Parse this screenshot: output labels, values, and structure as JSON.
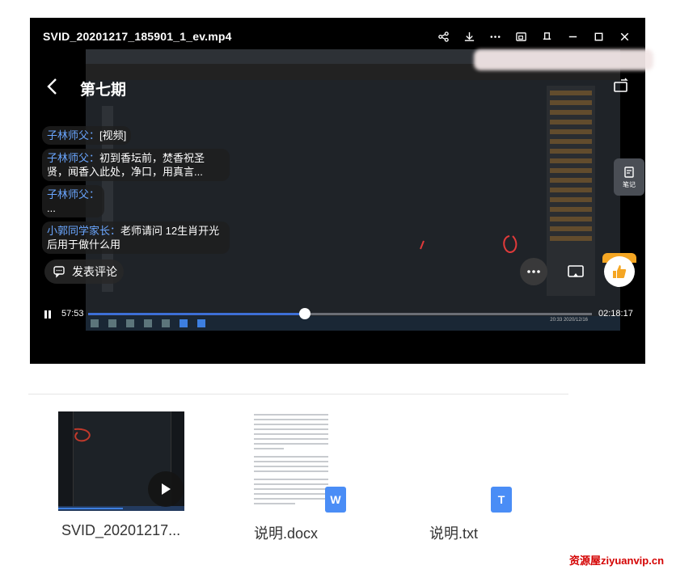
{
  "window": {
    "title": "SVID_20201217_185901_1_ev.mp4",
    "toolbar_icons": [
      "share-icon",
      "download-icon",
      "more-icon",
      "pip-icon",
      "pin-icon",
      "minimize-icon",
      "maximize-icon",
      "close-icon"
    ]
  },
  "player": {
    "episode_title": "第七期",
    "comments": [
      {
        "name": "子林师父：",
        "text": "[视频]"
      },
      {
        "name": "子林师父：",
        "text": "初到香坛前，焚香祝圣贤，闻香入此处，净口，用真言..."
      },
      {
        "name": "子林师父：",
        "text": "..."
      },
      {
        "name": "小郭同学家长：",
        "text": "老师请问 12生肖开光后用于做什么用"
      }
    ],
    "post_comment_label": "发表评论",
    "current_time": "57:53",
    "total_time": "02:18:17",
    "progress": 0.43,
    "note_label": "笔记",
    "taskbar_clock": "20:33 2020/12/16"
  },
  "attachments": [
    {
      "name": "SVID_20201217...",
      "type": "video"
    },
    {
      "name": "说明.docx",
      "type": "docx",
      "badge": "W",
      "color": "#4a8df6"
    },
    {
      "name": "说明.txt",
      "type": "txt",
      "badge": "T",
      "color": "#4a8df6"
    }
  ],
  "watermark": "资源屋ziyuanvip.cn"
}
